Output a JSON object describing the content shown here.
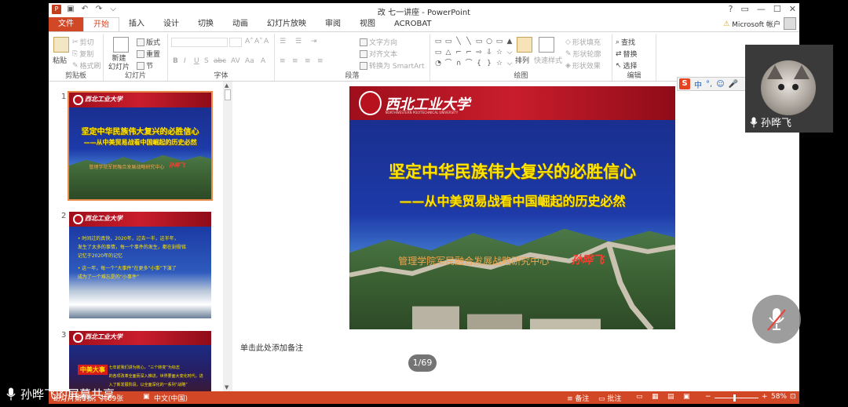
{
  "window": {
    "title": "改 七一讲座 - PowerPoint",
    "help": "?",
    "controls": [
      "▭",
      "—",
      "☐",
      "✕"
    ]
  },
  "qat": {
    "undo": "↶",
    "redo": "↷",
    "more": "⌵"
  },
  "tabs": [
    "文件",
    "开始",
    "插入",
    "设计",
    "切换",
    "动画",
    "幻灯片放映",
    "审阅",
    "视图",
    "ACROBAT"
  ],
  "account": {
    "label": "Microsoft 帐户",
    "warning": "⚠"
  },
  "ribbon": {
    "clipboard": {
      "label": "剪贴板",
      "paste": "粘贴",
      "cut": "剪切",
      "copy": "复制",
      "format_painter": "格式刷"
    },
    "slides": {
      "label": "幻灯片",
      "new_slide": "新建\n幻灯片",
      "layout": "版式",
      "reset": "重置",
      "section": "节"
    },
    "font": {
      "label": "字体",
      "bold": "B",
      "italic": "I",
      "underline": "U",
      "strike": "S",
      "abc": "abc",
      "spacing": "AV",
      "case": "Aa",
      "color": "A",
      "grow": "A˄",
      "shrink": "A˅",
      "clear": "A"
    },
    "paragraph": {
      "label": "段落",
      "text_direction": "文字方向",
      "align_text": "对齐文本",
      "smartart": "转换为 SmartArt"
    },
    "drawing": {
      "label": "绘图",
      "arrange": "排列",
      "quick_styles": "快速样式",
      "shape_fill": "形状填充",
      "shape_outline": "形状轮廓",
      "shape_effects": "形状效果"
    },
    "editing": {
      "label": "编辑",
      "find": "查找",
      "replace": "替换",
      "select": "选择"
    }
  },
  "thumbnails": [
    {
      "num": "1",
      "title": "坚定中华民族伟大复兴的必胜信心",
      "subtitle": "——从中美贸易战看中国崛起的历史必然",
      "org": "管理学院军民融合发展战略研究中心",
      "sign": "孙晔飞"
    },
    {
      "num": "2",
      "lines": [
        "• 时间过的真快，2020年，过去一半，这半年，",
        "发生了太多的事情，每一个事件的发生，都在刻骨铭",
        "记忆于2020年的记忆",
        "• 这一年，每一个“大事件”在更多“小事”下演了",
        "成为了一个难忘是的“小事件”"
      ]
    },
    {
      "num": "3",
      "tag": "中美大事",
      "lines": [
        "七年前我们讲为核心，“三个转变”为标志",
        "的各项改革全面而深入推进，世界要面大变化时代，进",
        "入了新发展阶段，以全面深化的一系列“战略”"
      ]
    }
  ],
  "slide": {
    "university_cn": "西北工业大学",
    "university_en": "NORTHWESTERN POLYTECHNICAL UNIVERSITY",
    "title": "坚定中华民族伟大复兴的必胜信心",
    "subtitle": "——从中美贸易战看中国崛起的历史必然",
    "org": "管理学院军民融合发展战略研究中心",
    "sign": "孙晔飞"
  },
  "notes_placeholder": "单击此处添加备注",
  "page_indicator": "1/69",
  "statusbar": {
    "slide_info": "幻灯片第1张，共69张",
    "language": "中文(中国)",
    "notes": "备注",
    "comments": "批注",
    "zoom_minus": "−",
    "zoom_plus": "+",
    "zoom": "58%"
  },
  "ime": {
    "brand": "S",
    "mode": "中",
    "punct": "°,",
    "emoji": "☺",
    "voice": "🎤"
  },
  "video": {
    "name": "孙晔飞"
  },
  "share": {
    "label": "孙晔飞的屏幕共享"
  },
  "colors": {
    "accent": "#d24726",
    "slide_title": "#ffe600",
    "header_red": "#b8121f"
  }
}
